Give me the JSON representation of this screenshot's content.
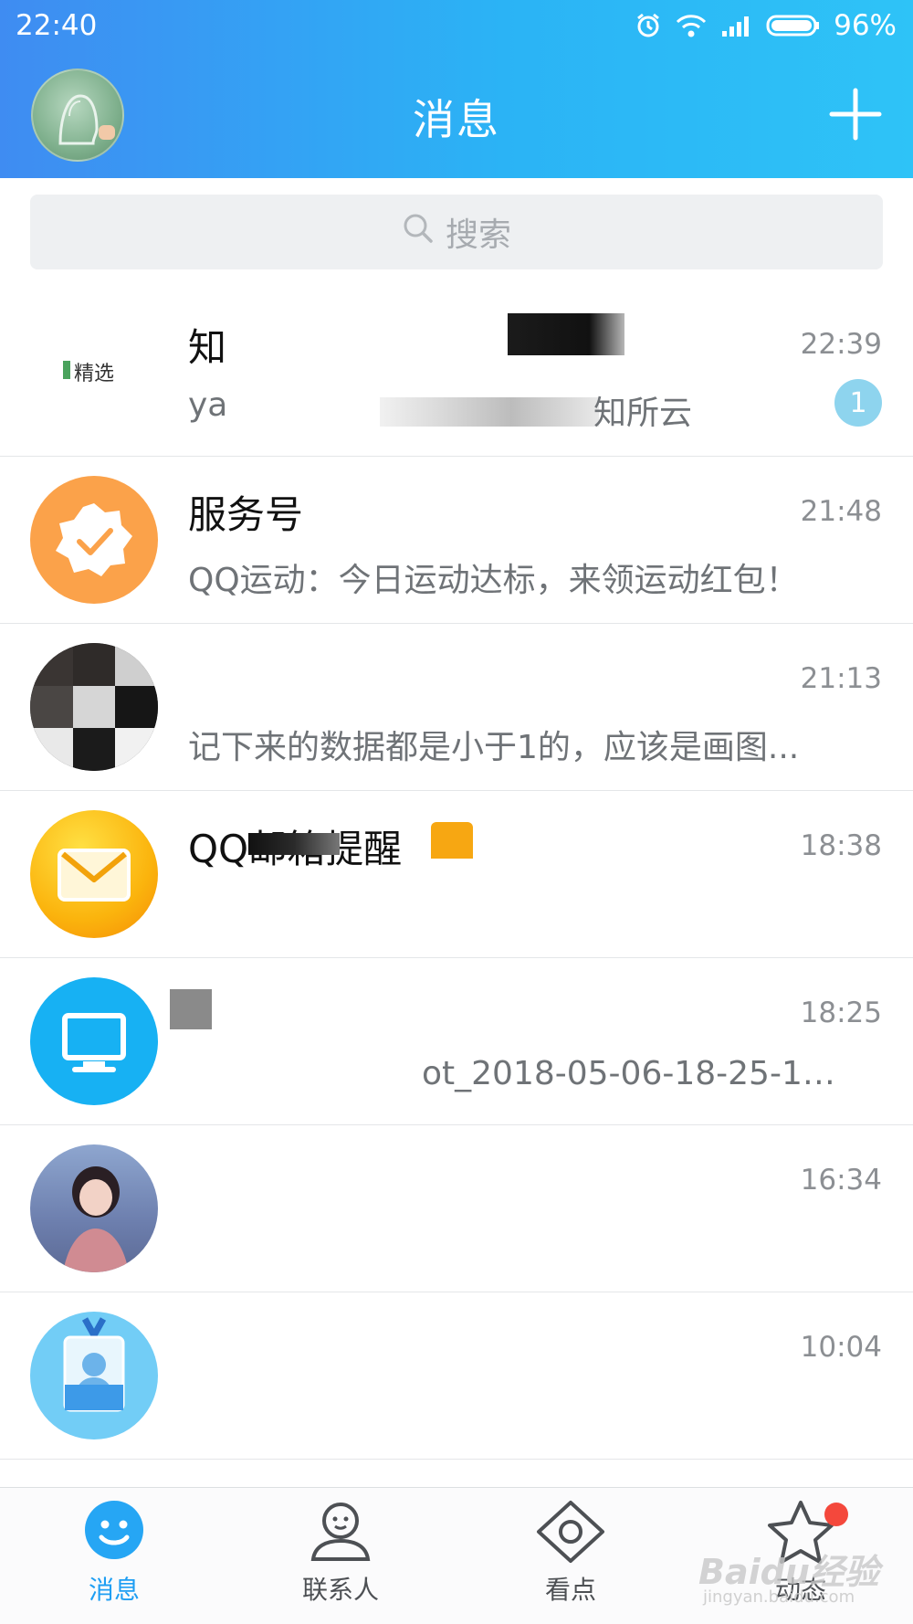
{
  "status_bar": {
    "time": "22:40",
    "battery": "96%"
  },
  "header": {
    "title": "消息"
  },
  "search": {
    "placeholder": "搜索"
  },
  "conversations": [
    {
      "name": "知",
      "time": "22:39",
      "preview": "ya",
      "preview_tail": "知所云",
      "avatar_text": "精选",
      "unread": "1"
    },
    {
      "name": "服务号",
      "time": "21:48",
      "preview": "QQ运动：今日运动达标，来领运动红包！"
    },
    {
      "name": "",
      "time": "21:13",
      "preview": "记下来的数据都是小于1的，应该是画图..."
    },
    {
      "name": "QQ邮箱提醒",
      "time": "18:38",
      "preview": ""
    },
    {
      "name": "",
      "time": "18:25",
      "preview": "ot_2018-05-06-18-25-15-..."
    },
    {
      "name": "",
      "time": "16:34",
      "preview": ""
    },
    {
      "name": "",
      "time": "10:04",
      "preview": ""
    }
  ],
  "tabs": [
    {
      "label": "消息",
      "icon": "smile-bubble-icon",
      "active": true
    },
    {
      "label": "联系人",
      "icon": "person-icon"
    },
    {
      "label": "看点",
      "icon": "eye-diamond-icon"
    },
    {
      "label": "动态",
      "icon": "star-icon"
    }
  ],
  "watermark": {
    "main": "Baidu经验",
    "sub": "jingyan.baidu.com"
  },
  "colors": {
    "header_start": "#3f8cf2",
    "header_end": "#2ec3f7",
    "accent": "#1e9ef3",
    "badge": "#8ed4ee",
    "red_dot": "#f4483c"
  }
}
